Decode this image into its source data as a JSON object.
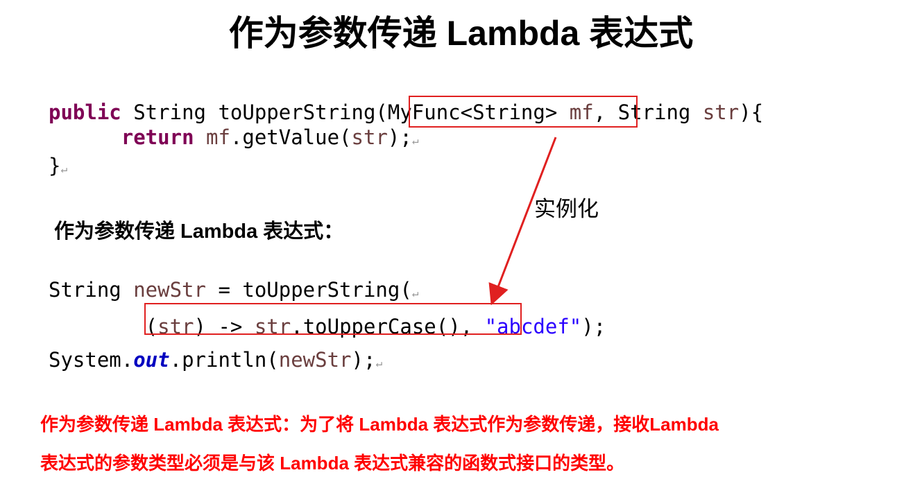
{
  "title": "作为参数传递 Lambda 表达式",
  "method_code": {
    "line1": {
      "kw_public": "public",
      "sig_start": " String toUpperString(",
      "param_type": "MyFunc<String> ",
      "param_name": "mf",
      "sig_rest": ", String ",
      "param_str": "str",
      "sig_end": "){"
    },
    "line2": {
      "indent": "      ",
      "kw_return": "return",
      "sp": " ",
      "var_mf": "mf",
      "call": ".getValue(",
      "var_str": "str",
      "end": ");"
    },
    "line3": {
      "brace": "}"
    }
  },
  "paragraph_mark": "↵",
  "instantiate_label": "实例化",
  "subheading": "作为参数传递 Lambda 表达式：",
  "call_code": {
    "line1": {
      "type": "String ",
      "var_newStr": "newStr",
      "assign": " = toUpperString(",
      "indent2": "       "
    },
    "line2": {
      "lambda_open": " (",
      "lambda_param": "str",
      "lambda_arrow": ") -> ",
      "lambda_var": "str",
      "lambda_call": ".toUpperCase()",
      "comma": ", ",
      "literal": "\"abcdef\"",
      "end": ");"
    },
    "line3": {
      "system": "System.",
      "field_out": "out",
      "println": ".println(",
      "var_newStr": "newStr",
      "end": ");"
    }
  },
  "note_line1": "作为参数传递 Lambda 表达式：为了将 Lambda 表达式作为参数传递，接收Lambda",
  "note_line2": "表达式的参数类型必须是与该 Lambda 表达式兼容的函数式接口的类型。",
  "colors": {
    "keyword": "#7f0055",
    "local_var": "#6a3e3e",
    "field": "#0000c0",
    "string_literal": "#2a00ff",
    "highlight": "#e02020",
    "note": "#ff0000"
  }
}
